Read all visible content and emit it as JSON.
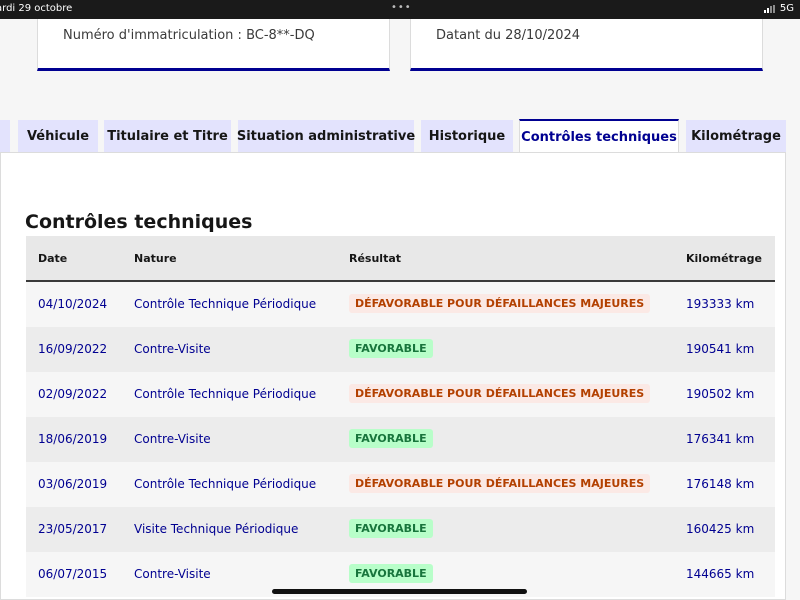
{
  "status_bar": {
    "time": "ardi 29 octobre",
    "dots": "•••",
    "network": "5G"
  },
  "top_cards": {
    "left": "Numéro d'immatriculation : BC-8**-DQ",
    "right": "Datant du 28/10/2024"
  },
  "tabs": [
    {
      "label": "Véhicule"
    },
    {
      "label": "Titulaire et Titre"
    },
    {
      "label": "Situation administrative"
    },
    {
      "label": "Historique"
    },
    {
      "label": "Contrôles techniques"
    },
    {
      "label": "Kilométrage"
    }
  ],
  "section_title": "Contrôles techniques",
  "table": {
    "headers": {
      "date": "Date",
      "nature": "Nature",
      "result": "Résultat",
      "km": "Kilométrage"
    },
    "rows": [
      {
        "date": "04/10/2024",
        "nature": "Contrôle Technique Périodique",
        "result": "DÉFAVORABLE POUR DÉFAILLANCES MAJEURES",
        "km": "193333 km"
      },
      {
        "date": "16/09/2022",
        "nature": "Contre-Visite",
        "result": "FAVORABLE",
        "km": "190541 km"
      },
      {
        "date": "02/09/2022",
        "nature": "Contrôle Technique Périodique",
        "result": "DÉFAVORABLE POUR DÉFAILLANCES MAJEURES",
        "km": "190502 km"
      },
      {
        "date": "18/06/2019",
        "nature": "Contre-Visite",
        "result": "FAVORABLE",
        "km": "176341 km"
      },
      {
        "date": "03/06/2019",
        "nature": "Contrôle Technique Périodique",
        "result": "DÉFAVORABLE POUR DÉFAILLANCES MAJEURES",
        "km": "176148 km"
      },
      {
        "date": "23/05/2017",
        "nature": "Visite Technique Périodique",
        "result": "FAVORABLE",
        "km": "160425 km"
      },
      {
        "date": "06/07/2015",
        "nature": "Contre-Visite",
        "result": "FAVORABLE",
        "km": "144665 km"
      }
    ]
  },
  "colors": {
    "primary": "#000091",
    "tab_bg": "#e3e3fd",
    "error_text": "#b34000",
    "error_bg": "#fbe9e5",
    "success_text": "#18753c",
    "success_bg": "#b8fec9"
  }
}
